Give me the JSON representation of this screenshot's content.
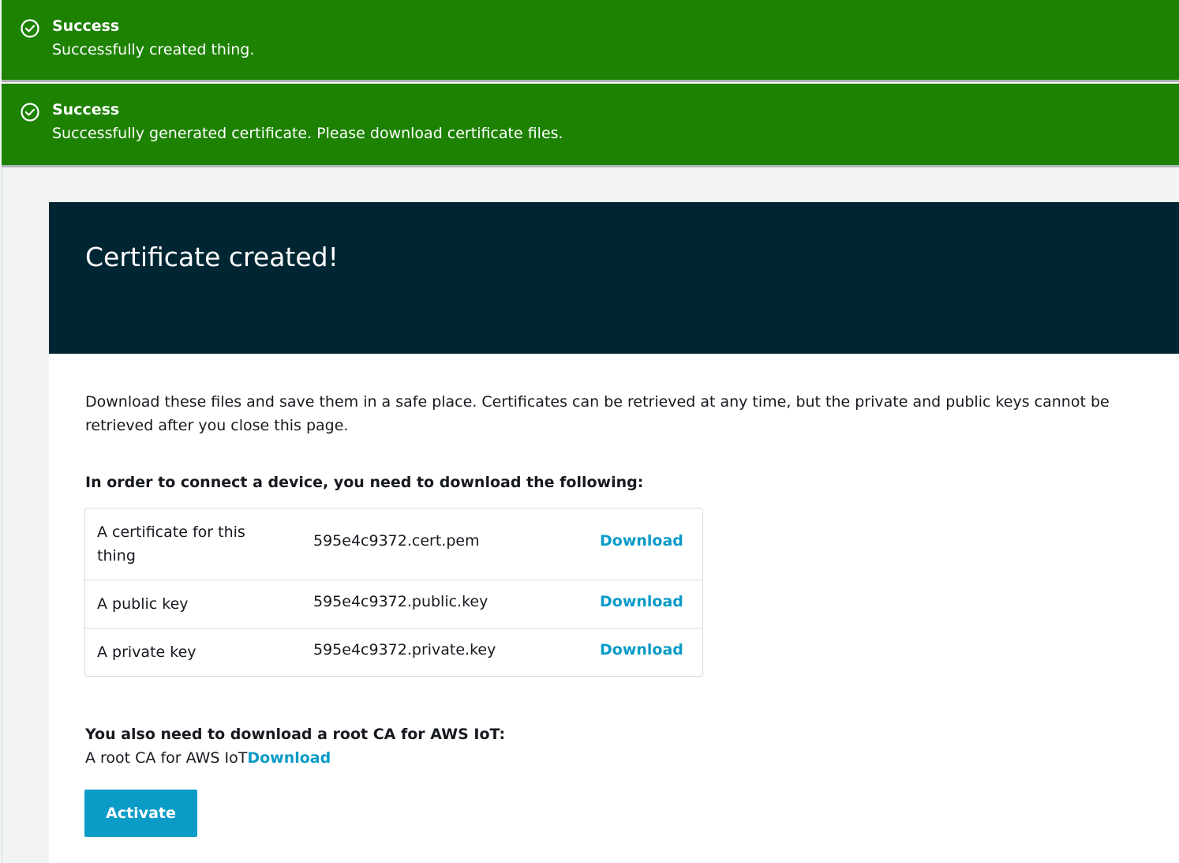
{
  "flashes": [
    {
      "title": "Success",
      "message": "Successfully created thing.",
      "icon": "check-circle-icon"
    },
    {
      "title": "Success",
      "message": "Successfully generated certificate. Please download certificate files.",
      "icon": "check-circle-icon"
    }
  ],
  "colors": {
    "success": "#1d8102",
    "header_bg": "#002633",
    "link": "#0a9bc7",
    "button": "#0a9bc7"
  },
  "card": {
    "title": "Certificate created!",
    "intro": "Download these files and save them in a safe place. Certificates can be retrieved at any time, but the private and public keys cannot be retrieved after you close this page.",
    "connect_label": "In order to connect a device, you need to download the following:",
    "files": [
      {
        "description": "A certificate for this thing",
        "filename": "595e4c9372.cert.pem",
        "action": "Download"
      },
      {
        "description": "A public key",
        "filename": "595e4c9372.public.key",
        "action": "Download"
      },
      {
        "description": "A private key",
        "filename": "595e4c9372.private.key",
        "action": "Download"
      }
    ],
    "root_ca_label": "You also need to download a root CA for AWS IoT:",
    "root_ca_text": "A root CA for AWS IoT",
    "root_ca_action": "Download",
    "activate_label": "Activate"
  }
}
